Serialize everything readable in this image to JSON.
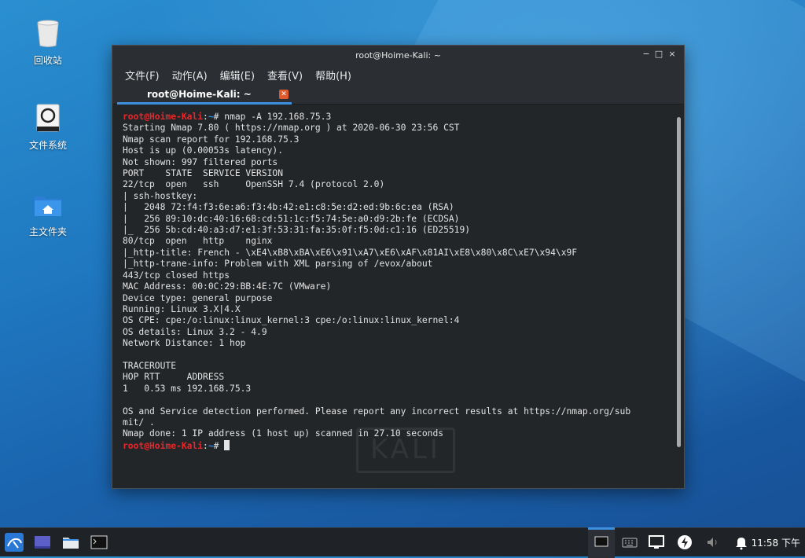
{
  "desktop": {
    "icons": [
      {
        "label": "回收站"
      },
      {
        "label": "文件系统"
      },
      {
        "label": "主文件夹"
      }
    ]
  },
  "window": {
    "title": "root@Hoime-Kali: ~",
    "controls": {
      "minimize": "−",
      "maximize": "□",
      "close": "×"
    },
    "menu": [
      "文件(F)",
      "动作(A)",
      "编辑(E)",
      "查看(V)",
      "帮助(H)"
    ],
    "tab": {
      "label": "root@Hoime-Kali: ~",
      "close": "✕"
    }
  },
  "terminal": {
    "prompt_user": "root@Hoime-Kali",
    "prompt_sep": ":",
    "prompt_path": "~",
    "prompt_sym": "# ",
    "command": "nmap -A 192.168.75.3",
    "output": "Starting Nmap 7.80 ( https://nmap.org ) at 2020-06-30 23:56 CST\nNmap scan report for 192.168.75.3\nHost is up (0.00053s latency).\nNot shown: 997 filtered ports\nPORT    STATE  SERVICE VERSION\n22/tcp  open   ssh     OpenSSH 7.4 (protocol 2.0)\n| ssh-hostkey: \n|   2048 72:f4:f3:6e:a6:f3:4b:42:e1:c8:5e:d2:ed:9b:6c:ea (RSA)\n|   256 89:10:dc:40:16:68:cd:51:1c:f5:74:5e:a0:d9:2b:fe (ECDSA)\n|_  256 5b:cd:40:a3:d7:e1:3f:53:31:fa:35:0f:f5:0d:c1:16 (ED25519)\n80/tcp  open   http    nginx\n|_http-title: French - \\xE4\\xB8\\xBA\\xE6\\x91\\xA7\\xE6\\xAF\\x81AI\\xE8\\x80\\x8C\\xE7\\x94\\x9F\n|_http-trane-info: Problem with XML parsing of /evox/about\n443/tcp closed https\nMAC Address: 00:0C:29:BB:4E:7C (VMware)\nDevice type: general purpose\nRunning: Linux 3.X|4.X\nOS CPE: cpe:/o:linux:linux_kernel:3 cpe:/o:linux:linux_kernel:4\nOS details: Linux 3.2 - 4.9\nNetwork Distance: 1 hop\n\nTRACEROUTE\nHOP RTT     ADDRESS\n1   0.53 ms 192.168.75.3\n\nOS and Service detection performed. Please report any incorrect results at https://nmap.org/sub\nmit/ .\nNmap done: 1 IP address (1 host up) scanned in 27.10 seconds\n",
    "watermark": "KALI"
  },
  "taskbar": {
    "items": [
      "kali-menu-icon",
      "workspace-icon",
      "file-manager-icon",
      "terminal-icon"
    ],
    "tray": [
      "active-window-icon",
      "keyboard-icon",
      "display-icon",
      "power-icon",
      "volume-icon",
      "notification-icon"
    ],
    "clock": "11:58 下午"
  },
  "colors": {
    "accent": "#3d8fe0",
    "prompt_user": "#e8272a",
    "prompt_path": "#2f8ae2",
    "terminal_bg": "#232629"
  }
}
